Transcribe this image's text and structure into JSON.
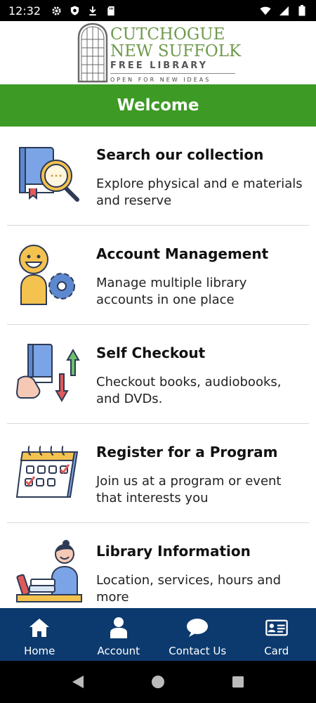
{
  "status_bar": {
    "time": "12:32",
    "left_icons": [
      "gear-icon",
      "shield-icon",
      "download-icon",
      "sd-card-icon"
    ],
    "right_icons": [
      "wifi-icon",
      "cellular-icon",
      "battery-icon"
    ]
  },
  "logo": {
    "line1": "CUTCHOGUE",
    "line2": "NEW SUFFOLK",
    "line3": "FREE LIBRARY",
    "line4": "OPEN FOR NEW IDEAS"
  },
  "welcome": {
    "title": "Welcome"
  },
  "menu": {
    "items": [
      {
        "title": "Search our collection",
        "description": "Explore physical and e materials and reserve",
        "icon": "book-magnifier-icon"
      },
      {
        "title": "Account Management",
        "description": "Manage multiple library accounts in one place",
        "icon": "person-gear-icon"
      },
      {
        "title": "Self Checkout",
        "description": "Checkout books, audiobooks, and DVDs.",
        "icon": "book-hand-arrows-icon"
      },
      {
        "title": "Register for a Program",
        "description": "Join us at a program or event that interests you",
        "icon": "calendar-icon"
      },
      {
        "title": "Library Information",
        "description": "Location, services, hours and more",
        "icon": "librarian-desk-icon"
      }
    ]
  },
  "bottom_nav": {
    "items": [
      {
        "label": "Home",
        "icon": "home-icon"
      },
      {
        "label": "Account",
        "icon": "person-icon"
      },
      {
        "label": "Contact Us",
        "icon": "chat-bubble-icon"
      },
      {
        "label": "Card",
        "icon": "id-card-icon"
      }
    ]
  },
  "colors": {
    "welcome_bg": "#3d9a24",
    "nav_bg": "#0c3a6e",
    "logo_green": "#6f9a4d"
  }
}
